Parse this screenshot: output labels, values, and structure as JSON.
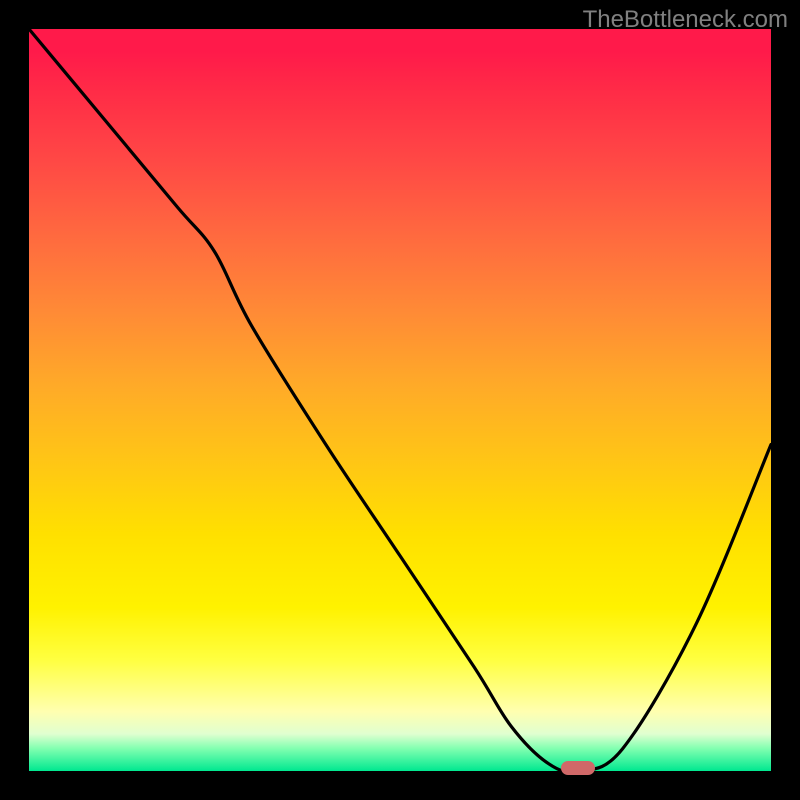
{
  "watermark": "TheBottleneck.com",
  "chart_data": {
    "type": "line",
    "title": "",
    "xlabel": "",
    "ylabel": "",
    "ylim": [
      0,
      100
    ],
    "xlim": [
      0,
      100
    ],
    "series": [
      {
        "name": "curve",
        "x": [
          0,
          10,
          20,
          25,
          30,
          40,
          50,
          60,
          65,
          70,
          74,
          80,
          90,
          100
        ],
        "y": [
          100,
          88,
          76,
          70,
          60,
          44,
          29,
          14,
          6,
          1,
          0,
          3,
          20,
          44
        ]
      }
    ],
    "marker": {
      "x": 74,
      "y": 0
    }
  }
}
